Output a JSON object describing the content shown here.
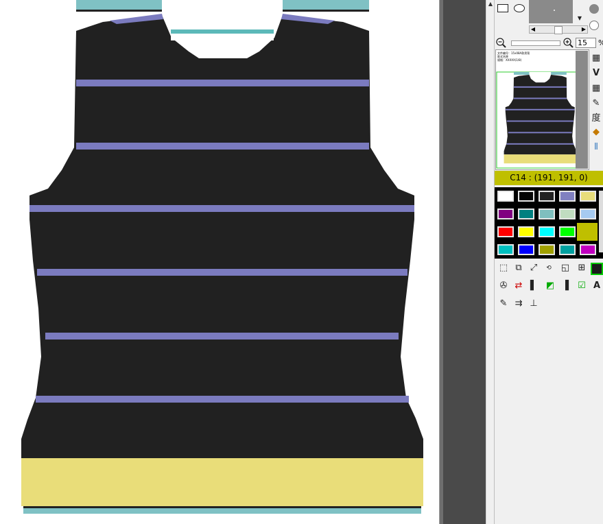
{
  "zoom": {
    "value": "15",
    "unit": "%"
  },
  "color_status": {
    "code": "C14",
    "rgb": "(191, 191, 0)",
    "label": "C14 : (191, 191, 0)"
  },
  "colors": {
    "garment_body": "#212121",
    "stripe": "#7b7bbf",
    "hem": "#e9dd79",
    "rib": "#7fc1c4",
    "neck_trim": "#5cb9b9",
    "selected": "#bfbf00"
  },
  "palette": [
    [
      "#ffffff",
      "#050505",
      "#222222",
      "#8080c0",
      "#e8dd7b"
    ],
    [
      "#800080",
      "#008080",
      "#7fbfbf",
      "#c0dcc0",
      "#a6caf0"
    ],
    [
      "#ff0000",
      "#ffff00",
      "#00ffff",
      "#00ff00",
      "#bfbf00"
    ],
    [
      "#00c0c0",
      "#0000ff",
      "#a0a000",
      "#00a0a0",
      "#c000c0"
    ]
  ],
  "thumbnail_caption": [
    "文件编号：15x08A款男背",
    "款式名称",
    "规格：XXXXX(1/8)"
  ],
  "icons": {
    "rect": "rectangle-shape-icon",
    "ellipse": "ellipse-shape-icon",
    "zoom_out": "zoom-out-icon",
    "zoom_in": "zoom-in-icon",
    "rotate": "rotate-360-icon",
    "text": "text-tool-icon",
    "degree": "度"
  }
}
